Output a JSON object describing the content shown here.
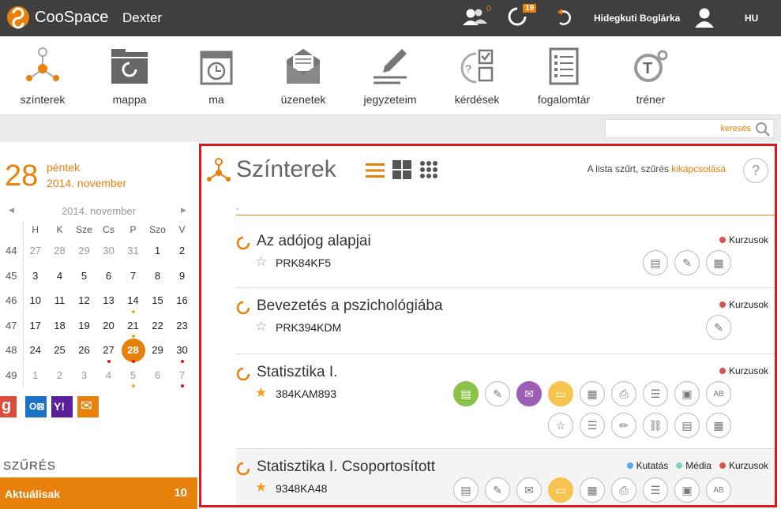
{
  "topbar": {
    "app_name": "CooSpace",
    "course": "Dexter",
    "people_badge": "0",
    "activity_badge": "19",
    "user_name": "Hidegkuti Boglárka",
    "lang": "HU"
  },
  "toolbar": {
    "items": [
      {
        "label": "színterek",
        "icon": "scenes-icon"
      },
      {
        "label": "mappa",
        "icon": "folder-icon"
      },
      {
        "label": "ma",
        "icon": "today-icon"
      },
      {
        "label": "üzenetek",
        "icon": "mail-icon"
      },
      {
        "label": "jegyzeteim",
        "icon": "notes-icon"
      },
      {
        "label": "kérdések",
        "icon": "questions-icon"
      },
      {
        "label": "fogalomtár",
        "icon": "glossary-icon"
      },
      {
        "label": "tréner",
        "icon": "trainer-icon"
      }
    ]
  },
  "search": {
    "placeholder": "keresés"
  },
  "date": {
    "day": "28",
    "weekday": "péntek",
    "month_year": "2014. november"
  },
  "calendar": {
    "month": "2014. november",
    "headers": [
      "H",
      "K",
      "Sze",
      "Cs",
      "P",
      "Szo",
      "V"
    ],
    "weeks": [
      {
        "wk": "44",
        "days": [
          "27",
          "28",
          "29",
          "30",
          "31",
          "1",
          "2"
        ]
      },
      {
        "wk": "45",
        "days": [
          "3",
          "4",
          "5",
          "6",
          "7",
          "8",
          "9"
        ]
      },
      {
        "wk": "46",
        "days": [
          "10",
          "11",
          "12",
          "13",
          "14",
          "15",
          "16"
        ]
      },
      {
        "wk": "47",
        "days": [
          "17",
          "18",
          "19",
          "20",
          "21",
          "22",
          "23"
        ]
      },
      {
        "wk": "48",
        "days": [
          "24",
          "25",
          "26",
          "27",
          "28",
          "29",
          "30"
        ]
      },
      {
        "wk": "49",
        "days": [
          "1",
          "2",
          "3",
          "4",
          "5",
          "6",
          "7"
        ]
      }
    ]
  },
  "filter": {
    "title": "SZŰRÉS",
    "item_label": "Aktuálisak",
    "item_count": "10"
  },
  "main": {
    "title": "Színterek",
    "filter_note": "A lista szűrt, szűrés ",
    "filter_link": "kikapcsolása",
    "help": "?",
    "dash": "-",
    "courses": [
      {
        "name": "Az adójog alapjai",
        "code": "PRK84KF5",
        "tags": [
          {
            "label": "Kurzusok",
            "color": "#d9534f"
          }
        ]
      },
      {
        "name": "Bevezetés a pszichológiába",
        "code": "PRK394KDM",
        "tags": [
          {
            "label": "Kurzusok",
            "color": "#d9534f"
          }
        ]
      },
      {
        "name": "Statisztika I.",
        "code": "384KAM893",
        "tags": [
          {
            "label": "Kurzusok",
            "color": "#d9534f"
          }
        ]
      },
      {
        "name": "Statisztika I. Csoportosított",
        "code": "9348KA48",
        "tags": [
          {
            "label": "Kutatás",
            "color": "#5aa9e6"
          },
          {
            "label": "Média",
            "color": "#7dd3c0"
          },
          {
            "label": "Kurzusok",
            "color": "#d9534f"
          }
        ]
      }
    ]
  }
}
